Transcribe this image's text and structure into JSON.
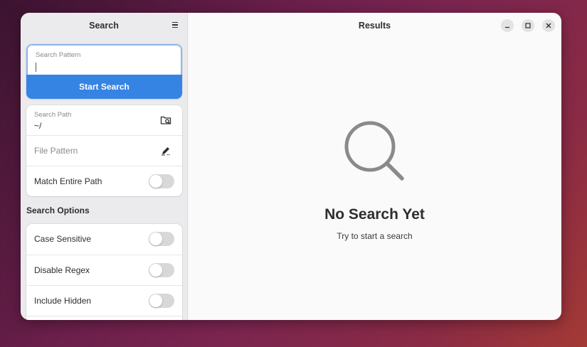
{
  "sidebar": {
    "title": "Search",
    "menu_icon": "hamburger-menu-icon",
    "pattern": {
      "label": "Search Pattern",
      "value": ""
    },
    "start_button": "Start Search",
    "path": {
      "label": "Search Path",
      "value": "~/",
      "icon": "folder-search-icon"
    },
    "file_pattern": {
      "placeholder": "File Pattern",
      "icon": "edit-pencil-icon"
    },
    "match_entire_path": {
      "label": "Match Entire Path",
      "on": false
    },
    "options_heading": "Search Options",
    "options": [
      {
        "label": "Case Sensitive",
        "on": false
      },
      {
        "label": "Disable Regex",
        "on": false
      },
      {
        "label": "Include Hidden",
        "on": false
      }
    ]
  },
  "main": {
    "title": "Results",
    "status": {
      "icon": "magnifier-icon",
      "title": "No Search Yet",
      "description": "Try to start a search"
    }
  },
  "window_controls": {
    "minimize": "minimize-icon",
    "maximize": "maximize-icon",
    "close": "close-icon"
  },
  "colors": {
    "accent": "#3584e4",
    "focus_border": "#8fb6ea",
    "sidebar_bg": "#ebebed",
    "content_bg": "#fafafa",
    "toggle_off": "#d8d8d8"
  }
}
